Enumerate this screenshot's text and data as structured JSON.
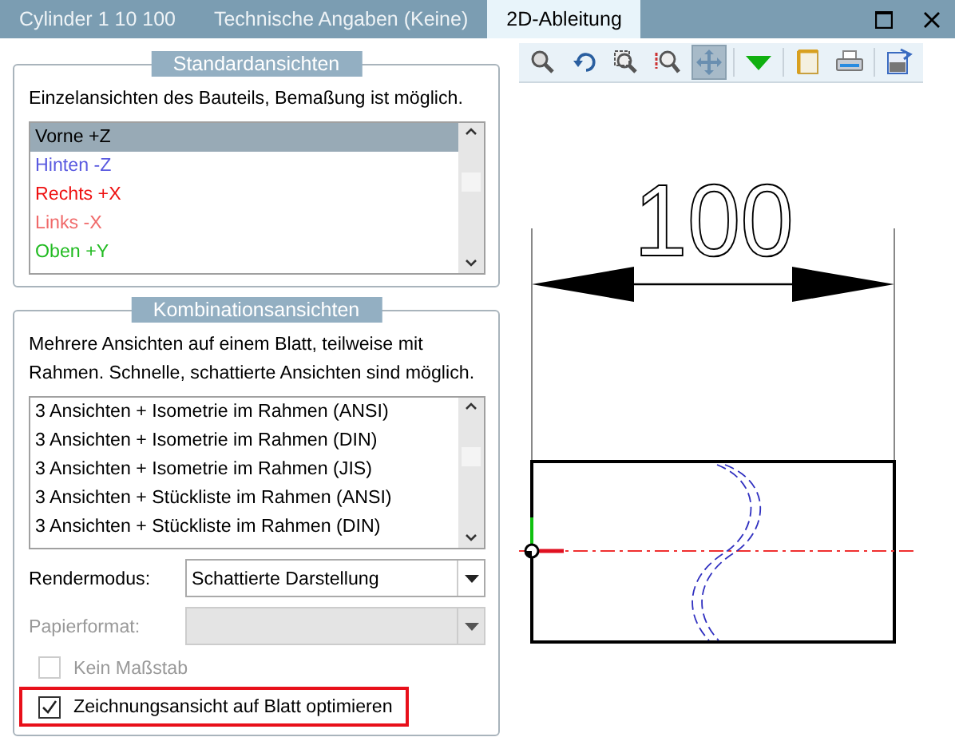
{
  "tabs": [
    {
      "label": "Cylinder 1 10 100",
      "selected": false
    },
    {
      "label": "Technische Angaben (Keine)",
      "selected": false
    },
    {
      "label": "2D-Ableitung",
      "selected": true
    }
  ],
  "standard_views": {
    "title": "Standardansichten",
    "description": "Einzelansichten des Bauteils, Bemaßung ist möglich.",
    "items": [
      {
        "label": "Vorne +Z",
        "selected": true,
        "color": "#000000"
      },
      {
        "label": "Hinten -Z",
        "selected": false,
        "color": "#5a5ae0"
      },
      {
        "label": "Rechts +X",
        "selected": false,
        "color": "#ee1111"
      },
      {
        "label": "Links -X",
        "selected": false,
        "color": "#f06a6a"
      },
      {
        "label": "Oben +Y",
        "selected": false,
        "color": "#22bb22"
      }
    ]
  },
  "combination_views": {
    "title": "Kombinationsansichten",
    "description": "Mehrere Ansichten auf einem Blatt, teilweise mit Rahmen. Schnelle, schattierte Ansichten sind möglich.",
    "items": [
      {
        "label": "3 Ansichten + Isometrie im Rahmen (ANSI)",
        "selected": false
      },
      {
        "label": "3 Ansichten + Isometrie im Rahmen (DIN)",
        "selected": false
      },
      {
        "label": "3 Ansichten + Isometrie im Rahmen (JIS)",
        "selected": false
      },
      {
        "label": "3 Ansichten + Stückliste im Rahmen (ANSI)",
        "selected": false
      },
      {
        "label": "3 Ansichten + Stückliste im Rahmen (DIN)",
        "selected": false
      }
    ],
    "fields": [
      {
        "label": "Rendermodus:",
        "value": "Schattierte Darstellung",
        "disabled": false
      },
      {
        "label": "Papierformat:",
        "disabled": true
      }
    ],
    "checkboxes": [
      {
        "label": "Kein Maßstab",
        "checked": false,
        "disabled": true,
        "highlighted": false
      },
      {
        "label": "Zeichnungsansicht auf Blatt optimieren",
        "checked": true,
        "disabled": false,
        "highlighted": true
      }
    ]
  },
  "toolbar": [
    {
      "kind": "zoom",
      "selected": false
    },
    {
      "kind": "undo",
      "selected": false
    },
    {
      "kind": "zoom-box",
      "selected": false
    },
    {
      "kind": "zoom-fit",
      "selected": false
    },
    {
      "kind": "pan",
      "selected": true
    },
    {
      "kind": "dropdown",
      "selected": false
    },
    {
      "kind": "sheet",
      "selected": false
    },
    {
      "kind": "print",
      "selected": false
    },
    {
      "kind": "export",
      "selected": false
    }
  ],
  "drawing": {
    "dimension": "100"
  }
}
